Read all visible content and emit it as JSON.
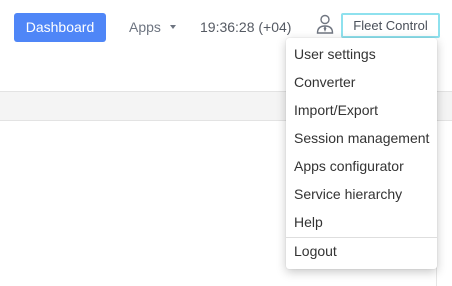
{
  "header": {
    "dashboard_label": "Dashboard",
    "apps_label": "Apps",
    "clock": "19:36:28 (+04)",
    "fleet_label": "Fleet Control"
  },
  "user_menu": {
    "items": [
      {
        "label": "User settings"
      },
      {
        "label": "Converter"
      },
      {
        "label": "Import/Export"
      },
      {
        "label": "Session management"
      },
      {
        "label": "Apps configurator"
      },
      {
        "label": "Service hierarchy"
      },
      {
        "label": "Help"
      },
      {
        "label": "Logout"
      }
    ]
  },
  "icons": {
    "user": "user-icon",
    "apps_caret": "caret-down-icon"
  },
  "colors": {
    "primary": "#4f86f7",
    "fleet_border": "#8ee1ee",
    "strip": "#f4f4f4"
  }
}
